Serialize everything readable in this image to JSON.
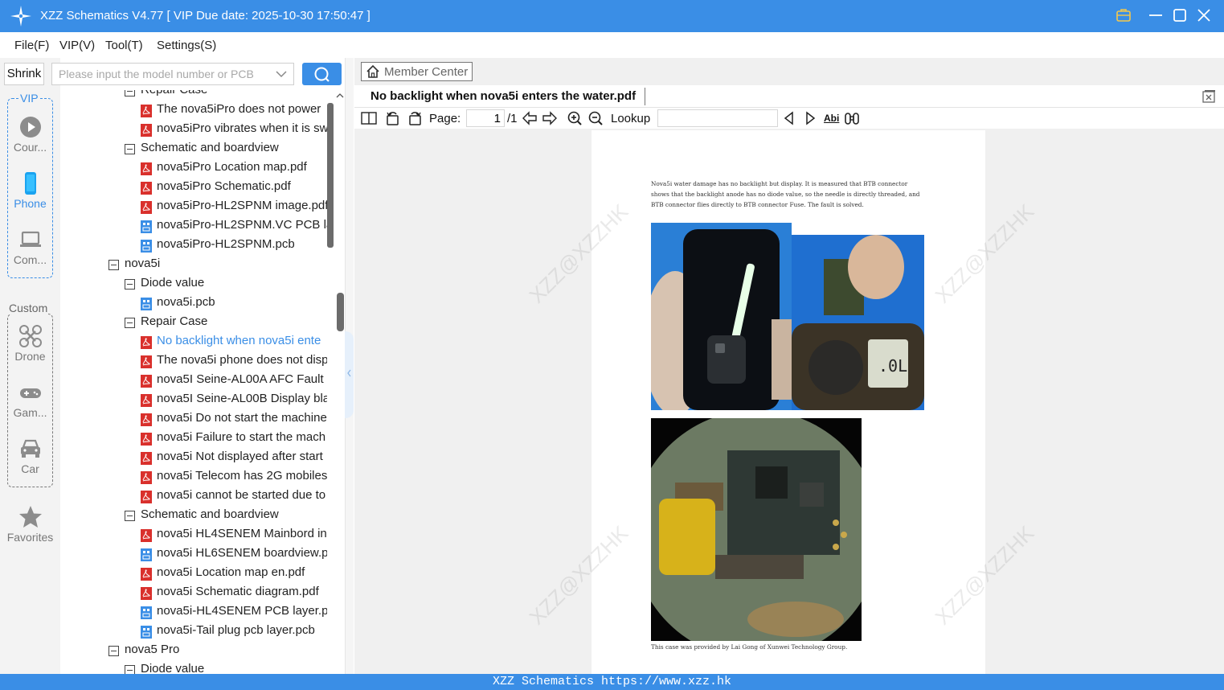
{
  "titlebar": {
    "title": "XZZ Schematics V4.77 [ VIP Due date: 2025-10-30 17:50:47 ]"
  },
  "menu": [
    {
      "label": "File(F)"
    },
    {
      "label": "VIP(V)"
    },
    {
      "label": "Tool(T)"
    },
    {
      "label": "Settings(S)"
    }
  ],
  "rail": {
    "vip_label": "VIP",
    "custom_label": "Custom",
    "items": [
      {
        "label": "Cour...",
        "icon": "play-icon"
      },
      {
        "label": "Phone",
        "icon": "phone-icon",
        "active": true
      },
      {
        "label": "Com...",
        "icon": "laptop-icon"
      },
      {
        "label": "Drone",
        "icon": "drone-icon"
      },
      {
        "label": "Gam...",
        "icon": "gamepad-icon"
      },
      {
        "label": "Car",
        "icon": "car-icon"
      },
      {
        "label": "Favorites",
        "icon": "star-icon"
      }
    ]
  },
  "search": {
    "shrink_label": "Shrink",
    "placeholder": "Please input the model number or PCB"
  },
  "tree": [
    {
      "label": "Repair Case",
      "type": "folder",
      "level": 1
    },
    {
      "label": "The nova5iPro does not power",
      "type": "pdf",
      "level": 2
    },
    {
      "label": "nova5iPro vibrates when it is sw",
      "type": "pdf",
      "level": 2
    },
    {
      "label": "Schematic and boardview",
      "type": "folder",
      "level": 1
    },
    {
      "label": "nova5iPro Location map.pdf",
      "type": "pdf",
      "level": 2
    },
    {
      "label": "nova5iPro Schematic.pdf",
      "type": "pdf",
      "level": 2
    },
    {
      "label": "nova5iPro-HL2SPNM image.pdf",
      "type": "pdf",
      "level": 2
    },
    {
      "label": "nova5iPro-HL2SPNM.VC PCB la",
      "type": "pcb",
      "level": 2
    },
    {
      "label": "nova5iPro-HL2SPNM.pcb",
      "type": "pcb",
      "level": 2
    },
    {
      "label": "nova5i",
      "type": "folder",
      "level": 0
    },
    {
      "label": "Diode value",
      "type": "folder",
      "level": 1
    },
    {
      "label": "nova5i.pcb",
      "type": "pcb",
      "level": 2
    },
    {
      "label": "Repair Case",
      "type": "folder",
      "level": 1
    },
    {
      "label": "No backlight when nova5i ente",
      "type": "pdf",
      "level": 2,
      "selected": true
    },
    {
      "label": "The nova5i phone does not disp",
      "type": "pdf",
      "level": 2
    },
    {
      "label": "nova5I Seine-AL00A AFC Fault (",
      "type": "pdf",
      "level": 2
    },
    {
      "label": "nova5I Seine-AL00B Display bla",
      "type": "pdf",
      "level": 2
    },
    {
      "label": "nova5i Do not start the machine",
      "type": "pdf",
      "level": 2
    },
    {
      "label": "nova5i Failure to start the mach",
      "type": "pdf",
      "level": 2
    },
    {
      "label": "nova5i Not displayed after start",
      "type": "pdf",
      "level": 2
    },
    {
      "label": "nova5i Telecom has 2G mobiles",
      "type": "pdf",
      "level": 2
    },
    {
      "label": "nova5i cannot be started due to",
      "type": "pdf",
      "level": 2
    },
    {
      "label": "Schematic and boardview",
      "type": "folder",
      "level": 1
    },
    {
      "label": "nova5i HL4SENEM Mainbord in",
      "type": "pdf",
      "level": 2
    },
    {
      "label": "nova5i HL6SENEM boardview.p",
      "type": "pcb",
      "level": 2
    },
    {
      "label": "nova5i Location map en.pdf",
      "type": "pdf",
      "level": 2
    },
    {
      "label": "nova5i Schematic diagram.pdf",
      "type": "pdf",
      "level": 2
    },
    {
      "label": "nova5i-HL4SENEM PCB layer.pc",
      "type": "pcb",
      "level": 2
    },
    {
      "label": "nova5i-Tail plug pcb layer.pcb",
      "type": "pcb",
      "level": 2
    },
    {
      "label": "nova5 Pro",
      "type": "folder",
      "level": 0
    },
    {
      "label": "Diode value",
      "type": "folder",
      "level": 1
    }
  ],
  "viewer": {
    "member_center": "Member Center",
    "doc_title": "No backlight when nova5i enters the water.pdf",
    "page_label": "Page:",
    "page_current": "1",
    "page_total": "/1",
    "lookup_label": "Lookup",
    "abi_label": "Abi"
  },
  "document": {
    "paragraph": "Nova5i water damage has no backlight but display. It is measured that BTB connector shows that the backlight anode has no diode value, so the needle is directly threaded, and BTB connector flies directly to BTB connector Fuse. The fault is solved.",
    "credit": "This case was provided by Lai Gong of Xunwei Technology Group.",
    "watermark": "XZZ@XZZHK"
  },
  "statusbar": {
    "text": "XZZ Schematics https://www.xzz.hk"
  },
  "colors": {
    "accent": "#3a8ee6",
    "pdf_icon": "#d9302c",
    "pcb_icon": "#3a8ee6"
  }
}
